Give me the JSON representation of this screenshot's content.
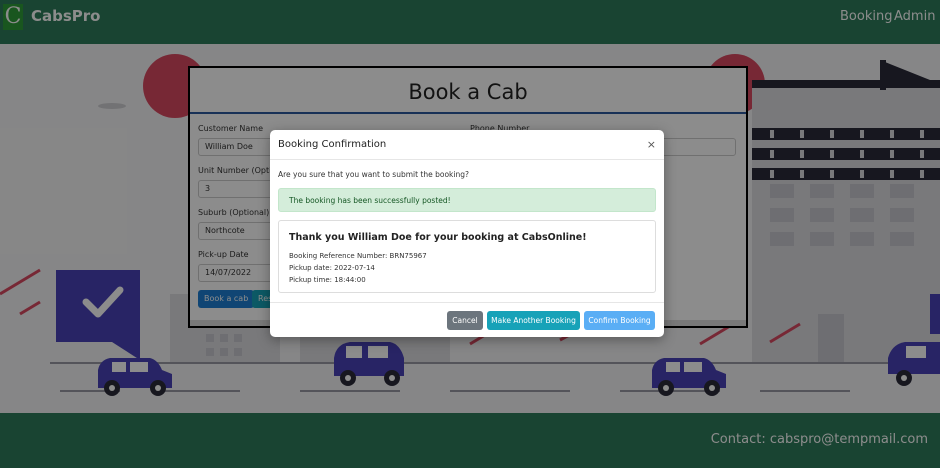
{
  "navbar": {
    "logo_letter": "C",
    "brand": "CabsPro",
    "links": [
      "Booking",
      "Admin"
    ]
  },
  "footer": {
    "contact": "Contact: cabspro@tempmail.com"
  },
  "book_form": {
    "title": "Book a Cab",
    "customer_name_label": "Customer Name",
    "customer_name_value": "William Doe",
    "phone_label": "Phone Number",
    "unit_label": "Unit Number (Option",
    "unit_value": "3",
    "suburb_label": "Suburb (Optional)",
    "suburb_value": "Northcote",
    "pickup_date_label": "Pick-up Date",
    "pickup_date_value": "14/07/2022",
    "book_button": "Book a cab",
    "reset_button": "Rese"
  },
  "modal": {
    "title": "Booking Confirmation",
    "close": "×",
    "question": "Are you sure that you want to submit the booking?",
    "alert": "The booking has been successfully posted!",
    "card": {
      "heading": "Thank you William Doe for your booking at CabsOnline!",
      "reference": "Booking Reference Number: BRN75967",
      "pickup_date": "Pickup date: 2022-07-14",
      "pickup_time": "Pickup time: 18:44:00"
    },
    "buttons": {
      "cancel": "Cancel",
      "another": "Make Another Booking",
      "confirm": "Confirm Booking"
    }
  },
  "colors": {
    "navbar": "#2e7d5b",
    "cancel": "#6c757d",
    "another": "#17a2b8",
    "confirm": "#5aaef5",
    "book": "#1e7fd3",
    "alert_bg": "#d4edda"
  }
}
